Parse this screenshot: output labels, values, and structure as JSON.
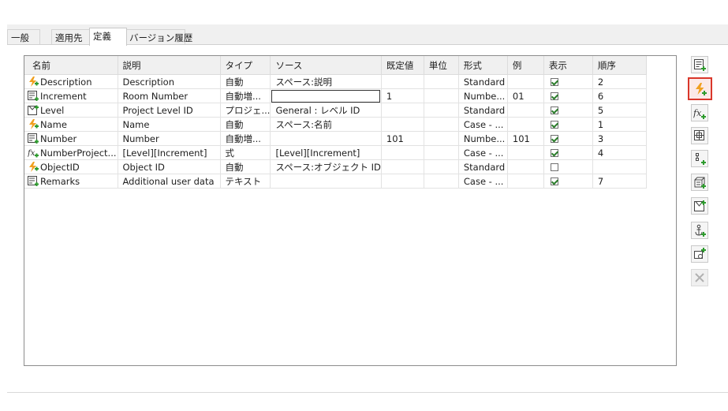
{
  "tabs": [
    {
      "label": "一般"
    },
    {
      "label": "適用先"
    },
    {
      "label": "定義",
      "active": true
    },
    {
      "label": "バージョン履歴"
    }
  ],
  "table": {
    "columns": [
      "名前",
      "説明",
      "タイプ",
      "ソース",
      "既定値",
      "単位",
      "形式",
      "例",
      "表示",
      "順序"
    ],
    "rows": [
      {
        "icon": "lightning-plus-icon",
        "name": "Description",
        "description": "Description",
        "type": "自動",
        "source": "スペース:説明",
        "default": "",
        "unit": "",
        "format": "Standard",
        "example": "",
        "visible": true,
        "order": "2"
      },
      {
        "icon": "number-field-icon",
        "name": "Increment",
        "description": "Room Number",
        "type": "自動増...",
        "source": "",
        "default": "1",
        "unit": "",
        "format": "Numbe...",
        "example": "01",
        "visible": true,
        "order": "6",
        "editing_source": true
      },
      {
        "icon": "level-icon",
        "name": "Level",
        "description": "Project Level ID",
        "type": "プロジェ...",
        "source": "General : レベル ID",
        "default": "",
        "unit": "",
        "format": "Standard",
        "example": "",
        "visible": true,
        "order": "5"
      },
      {
        "icon": "lightning-plus-icon",
        "name": "Name",
        "description": "Name",
        "type": "自動",
        "source": "スペース:名前",
        "default": "",
        "unit": "",
        "format": "Case - ...",
        "example": "",
        "visible": true,
        "order": "1"
      },
      {
        "icon": "number-field-icon",
        "name": "Number",
        "description": "Number",
        "type": "自動増...",
        "source": "",
        "default": "101",
        "unit": "",
        "format": "Numbe...",
        "example": "101",
        "visible": true,
        "order": "3"
      },
      {
        "icon": "formula-icon",
        "name": "NumberProject...",
        "description": "[Level][Increment]",
        "type": "式",
        "source": "[Level][Increment]",
        "default": "",
        "unit": "",
        "format": "Case - ...",
        "example": "",
        "visible": true,
        "order": "4"
      },
      {
        "icon": "lightning-plus-icon",
        "name": "ObjectID",
        "description": "Object ID",
        "type": "自動",
        "source": "スペース:オブジェクト ID",
        "default": "",
        "unit": "",
        "format": "Standard",
        "example": "",
        "visible": false,
        "order": ""
      },
      {
        "icon": "number-field-icon",
        "name": "Remarks",
        "description": "Additional user data",
        "type": "テキスト",
        "source": "",
        "default": "",
        "unit": "",
        "format": "Case - ...",
        "example": "",
        "visible": true,
        "order": "7"
      }
    ]
  },
  "side_buttons": [
    {
      "icon": "add-text-property-icon"
    },
    {
      "icon": "add-automatic-property-icon",
      "selected": true
    },
    {
      "icon": "add-formula-property-icon"
    },
    {
      "icon": "add-group-property-icon"
    },
    {
      "icon": "add-list-property-icon"
    },
    {
      "icon": "add-table-property-icon"
    },
    {
      "icon": "add-level-property-icon"
    },
    {
      "icon": "add-anchor-property-icon"
    },
    {
      "icon": "add-reference-property-icon"
    },
    {
      "icon": "delete-property-icon",
      "disabled": true
    }
  ],
  "colors": {
    "accent_orange": "#f0a020",
    "icon_green": "#2e9b2e",
    "selected_border": "#d9372b"
  }
}
